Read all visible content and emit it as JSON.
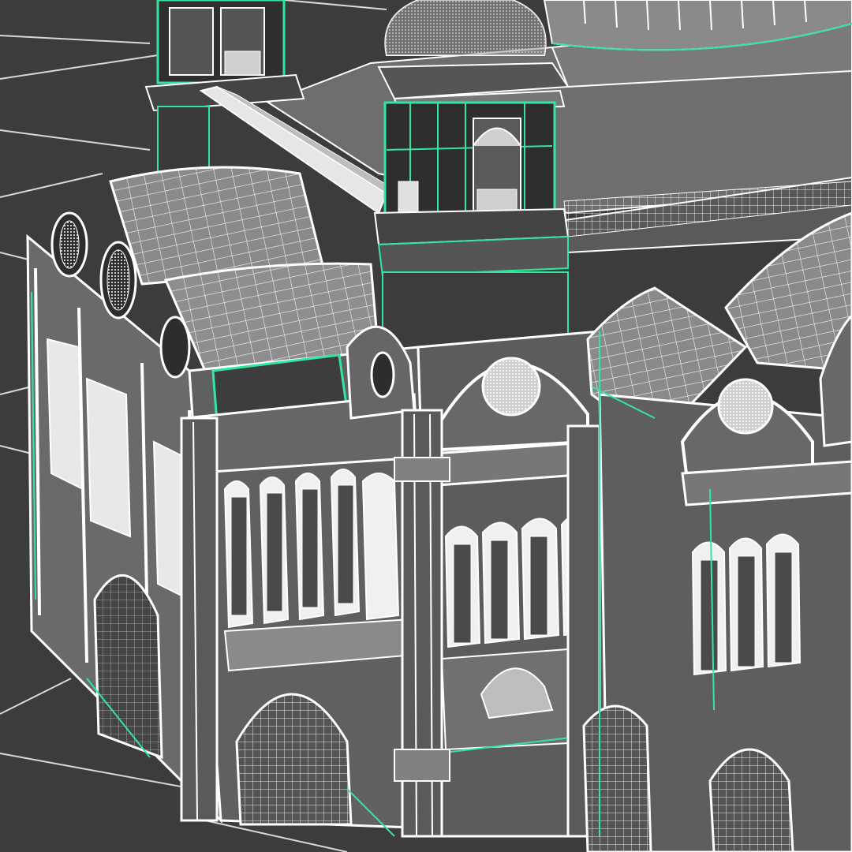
{
  "viewport": {
    "render_mode": "wireframe-on-shaded",
    "subject": "cathedral-model",
    "colors": {
      "background": "#3c3c3c",
      "ground_lines": "#d8d8d8",
      "wire": "#ffffff",
      "selected_wire": "#33e6a0",
      "face_light": "#8a8a8a",
      "face_mid": "#6e6e6e",
      "face_dark": "#444444",
      "face_shadow": "#2e2e2e",
      "face_roof": "#7b7b7b"
    }
  }
}
